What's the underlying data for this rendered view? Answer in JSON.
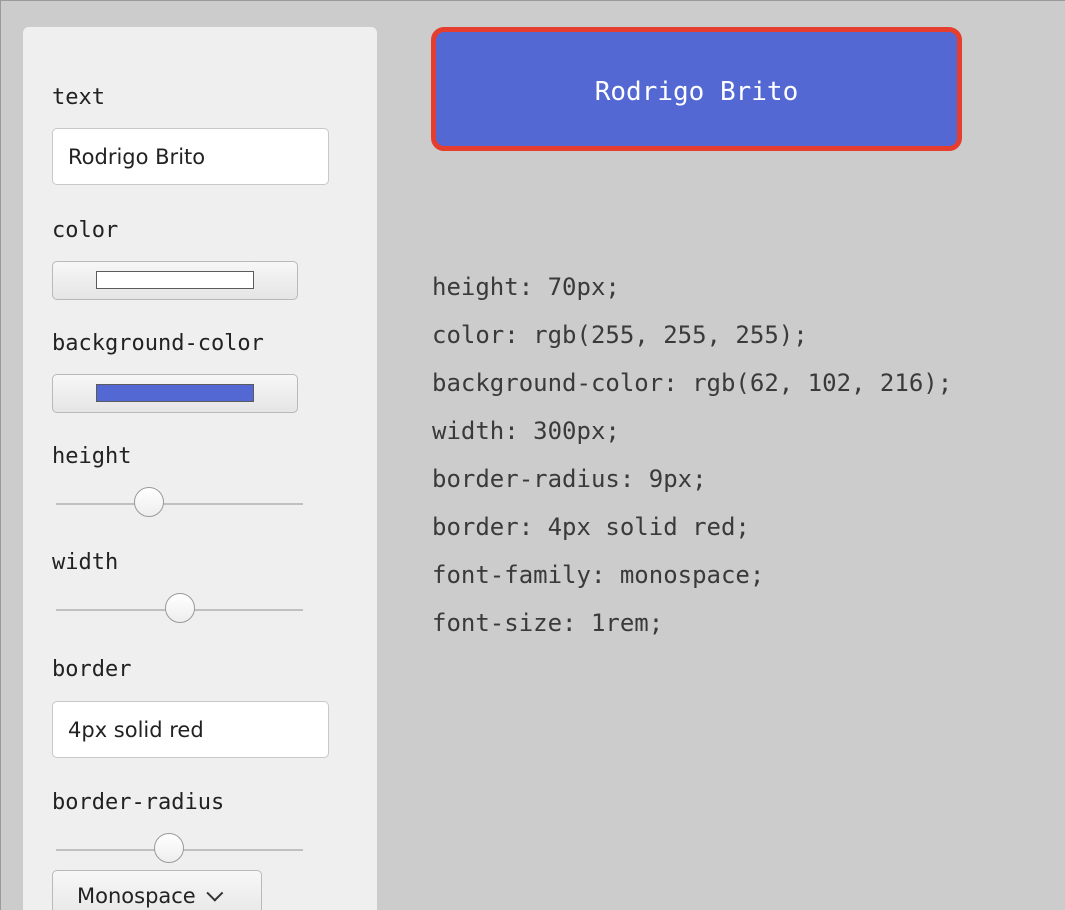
{
  "controls": {
    "text": {
      "label": "text",
      "value": "Rodrigo Brito"
    },
    "color": {
      "label": "color",
      "value": "#ffffff"
    },
    "background_color": {
      "label": "background-color",
      "value": "#5368d3"
    },
    "height": {
      "label": "height",
      "value": 70
    },
    "width": {
      "label": "width",
      "value": 300
    },
    "border": {
      "label": "border",
      "value": "4px solid red"
    },
    "border_radius": {
      "label": "border-radius",
      "value": 9
    },
    "font_family": {
      "selected": "Monospace"
    }
  },
  "preview": {
    "text": "Rodrigo Brito",
    "text_color": "#ffffff",
    "background_color": "#5368d3",
    "border_color": "#e53e2f"
  },
  "css_output": [
    "height: 70px;",
    "color: rgb(255, 255, 255);",
    "background-color: rgb(62, 102, 216);",
    "width: 300px;",
    "border-radius: 9px;",
    "border: 4px solid red;",
    "font-family: monospace;",
    "font-size: 1rem;"
  ],
  "icons": {
    "font_select": "chevron-down-icon"
  }
}
